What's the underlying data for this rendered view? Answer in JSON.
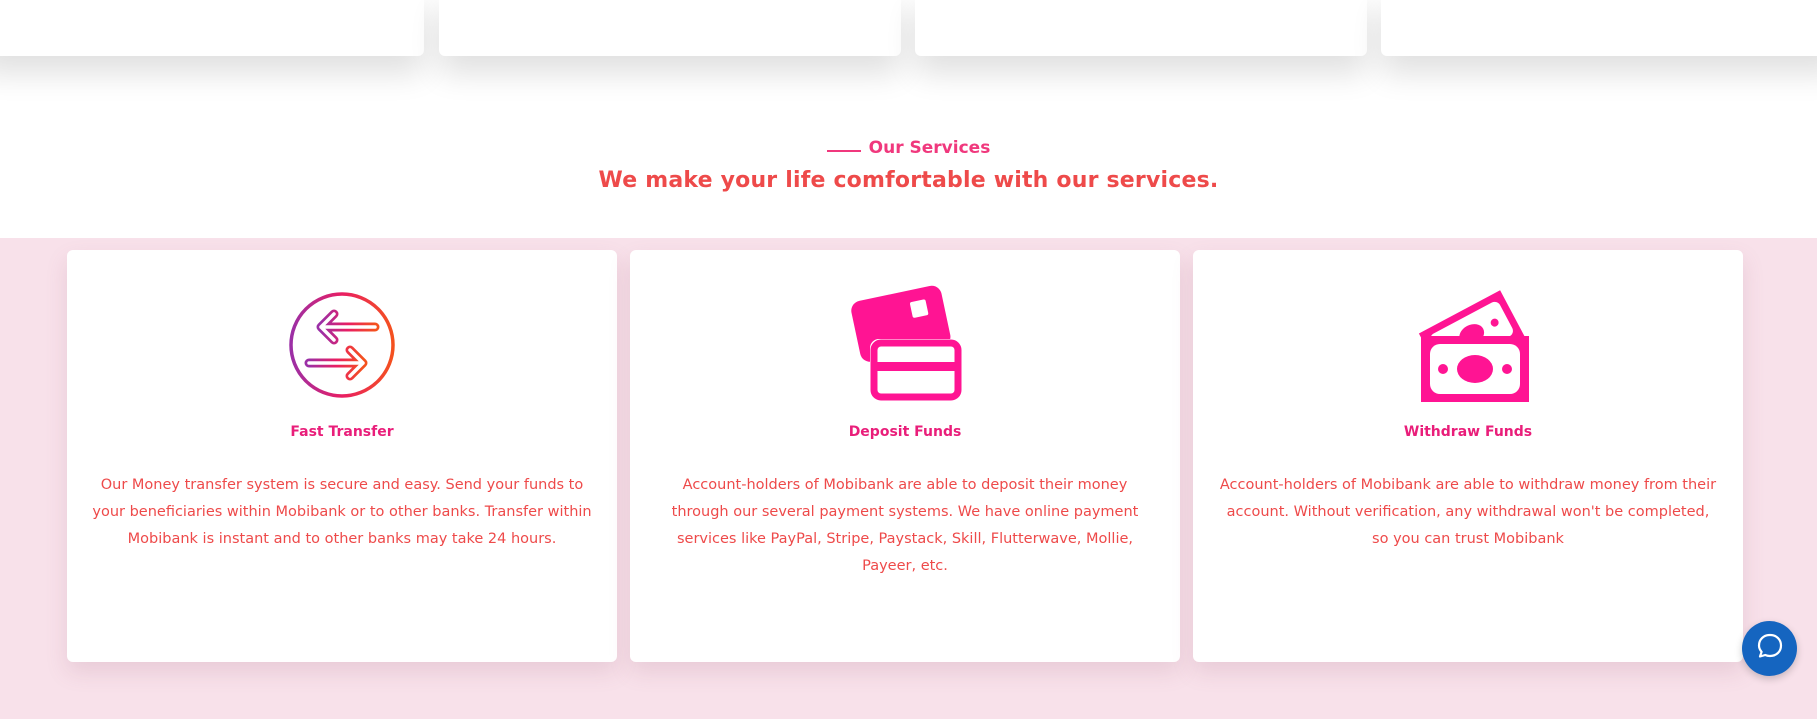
{
  "section": {
    "eyebrow": "Our Services",
    "headline": "We make your life comfortable with our services."
  },
  "services": [
    {
      "title": "Fast Transfer",
      "icon": "transfer-arrows-icon",
      "description": "Our Money transfer system is secure and easy. Send your funds to your beneficiaries within Mobibank or to other banks. Transfer within Mobibank is instant and to other banks may take 24 hours."
    },
    {
      "title": "Deposit Funds",
      "icon": "credit-cards-icon",
      "description": "Account-holders of Mobibank are able to deposit their money through our several payment systems. We have online payment services like PayPal, Stripe, Paystack, Skill, Flutterwave, Mollie, Payeer, etc."
    },
    {
      "title": "Withdraw Funds",
      "icon": "banknotes-icon",
      "description": "Account-holders of Mobibank are able to withdraw money from their account. Without verification, any withdrawal won't be completed, so you can trust Mobibank"
    }
  ],
  "colors": {
    "accent": "#f0387d",
    "heading": "#ee4a4a",
    "icon": "#ff1493",
    "band": "#f8e1ea",
    "chat": "#1565c0"
  },
  "chat": {
    "icon": "chat-bubble-icon"
  }
}
